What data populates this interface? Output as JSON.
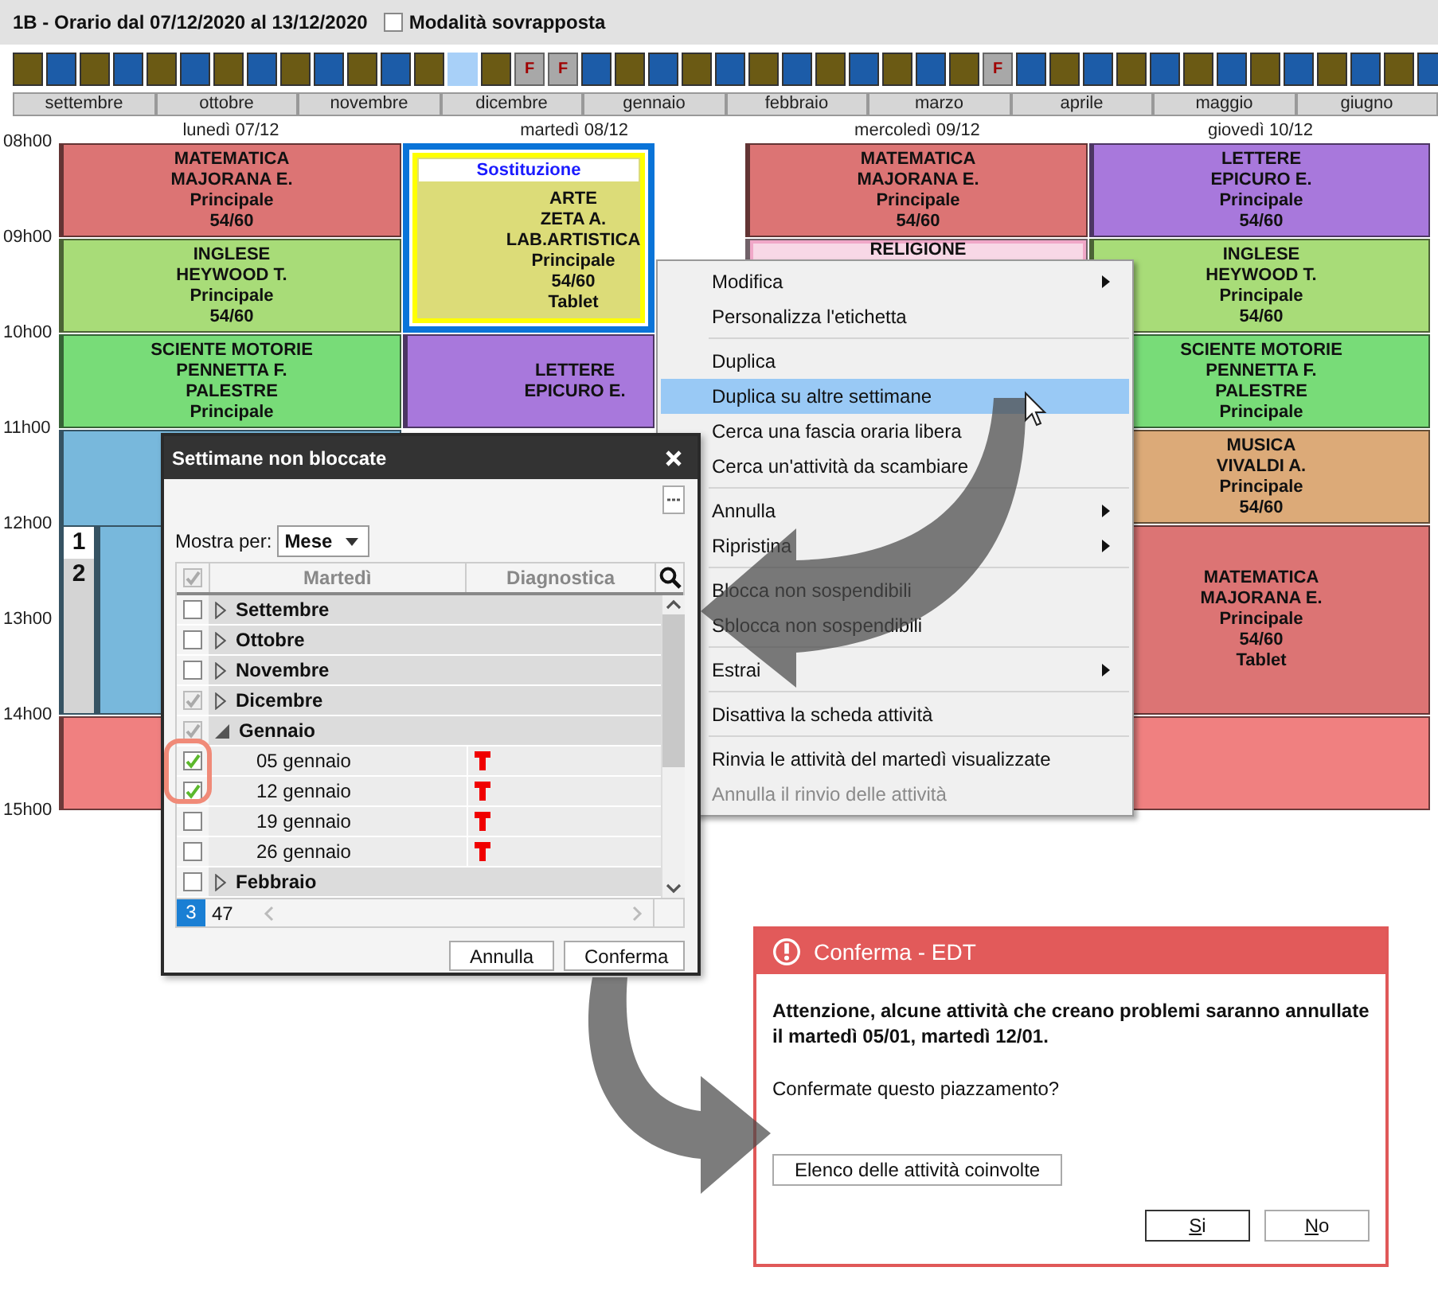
{
  "header": {
    "title": "1B - Orario dal 07/12/2020 al 13/12/2020",
    "overlay_mode": {
      "label": "Modalità sovrapposta",
      "checked": false
    }
  },
  "weeks": [
    {
      "kind": "a"
    },
    {
      "kind": "b"
    },
    {
      "kind": "a"
    },
    {
      "kind": "b"
    },
    {
      "kind": "a"
    },
    {
      "kind": "b"
    },
    {
      "kind": "a"
    },
    {
      "kind": "b"
    },
    {
      "kind": "a"
    },
    {
      "kind": "b"
    },
    {
      "kind": "a"
    },
    {
      "kind": "b"
    },
    {
      "kind": "a"
    },
    {
      "kind": "current"
    },
    {
      "kind": "a"
    },
    {
      "kind": "holiday",
      "label": "F"
    },
    {
      "kind": "holiday",
      "label": "F"
    },
    {
      "kind": "b"
    },
    {
      "kind": "a"
    },
    {
      "kind": "b"
    },
    {
      "kind": "a"
    },
    {
      "kind": "b"
    },
    {
      "kind": "a"
    },
    {
      "kind": "b"
    },
    {
      "kind": "a"
    },
    {
      "kind": "b"
    },
    {
      "kind": "a"
    },
    {
      "kind": "b"
    },
    {
      "kind": "a"
    },
    {
      "kind": "holiday",
      "label": "F"
    },
    {
      "kind": "b"
    },
    {
      "kind": "a"
    },
    {
      "kind": "b"
    },
    {
      "kind": "a"
    },
    {
      "kind": "b"
    },
    {
      "kind": "a"
    },
    {
      "kind": "b"
    },
    {
      "kind": "a"
    },
    {
      "kind": "b"
    },
    {
      "kind": "a"
    },
    {
      "kind": "b"
    },
    {
      "kind": "a"
    },
    {
      "kind": "b"
    }
  ],
  "months": [
    "settembre",
    "ottobre",
    "novembre",
    "dicembre",
    "gennaio",
    "febbraio",
    "marzo",
    "aprile",
    "maggio",
    "giugno"
  ],
  "timetable": {
    "hours": [
      "08h00",
      "09h00",
      "10h00",
      "11h00",
      "12h00",
      "13h00",
      "14h00",
      "15h00"
    ],
    "days": [
      {
        "label": "lunedì 07/12",
        "lessons": [
          {
            "kind": "lesson",
            "long": false,
            "color": "#dc7474",
            "selected": false,
            "lines": [
              "MATEMATICA",
              "MAJORANA E.",
              "Principale",
              "54/60"
            ]
          },
          {
            "kind": "lesson",
            "long": false,
            "color": "#a8dc78",
            "selected": false,
            "lines": [
              "INGLESE",
              "HEYWOOD T.",
              "Principale",
              "54/60"
            ]
          },
          {
            "kind": "lesson",
            "long": false,
            "color": "#78dc78",
            "selected": false,
            "lines": [
              "SCIENTE MOTORIE",
              "PENNETTA F.",
              "PALESTRE",
              "Principale"
            ]
          },
          {
            "kind": "group",
            "color": "#78b8dc",
            "selected": false,
            "parts": [
              {
                "label": "1",
                "selected": true
              },
              {
                "label": "2",
                "selected": false
              }
            ]
          },
          {
            "kind": "empty",
            "long": false,
            "color": "#f08080",
            "selected": false
          }
        ]
      },
      {
        "label": "martedì 08/12",
        "lessons": [
          {
            "kind": "substitution",
            "long": true,
            "color": "#dcdc78",
            "selected": true,
            "banner": "Sostituzione",
            "lines": [
              "ARTE",
              "ZETA A.",
              "LAB.ARTISTICA",
              "Principale",
              "54/60",
              "Tablet"
            ]
          },
          {
            "kind": "lesson",
            "long": false,
            "color": "#a878dc",
            "selected": false,
            "lines": [
              "LETTERE",
              "EPICURO E."
            ]
          }
        ]
      },
      {
        "label": "mercoledì 09/12",
        "lessons": [
          {
            "kind": "lesson",
            "long": false,
            "color": "#dc7474",
            "selected": false,
            "lines": [
              "MATEMATICA",
              "MAJORANA E.",
              "Principale",
              "54/60"
            ]
          },
          {
            "kind": "inset",
            "long": false,
            "color": "#f8d8e6",
            "selected": false,
            "lines": [
              "RELIGIONE"
            ]
          }
        ]
      },
      {
        "label": "giovedì 10/12",
        "lessons": [
          {
            "kind": "lesson",
            "long": false,
            "color": "#a878dc",
            "selected": false,
            "lines": [
              "LETTERE",
              "EPICURO E.",
              "Principale",
              "54/60"
            ]
          },
          {
            "kind": "lesson",
            "long": false,
            "color": "#a8dc78",
            "selected": false,
            "lines": [
              "INGLESE",
              "HEYWOOD T.",
              "Principale",
              "54/60"
            ]
          },
          {
            "kind": "lesson",
            "long": false,
            "color": "#78dc78",
            "selected": false,
            "lines": [
              "SCIENTE MOTORIE",
              "PENNETTA F.",
              "PALESTRE",
              "Principale"
            ]
          },
          {
            "kind": "lesson",
            "long": false,
            "color": "#dcaa78",
            "selected": false,
            "lines": [
              "MUSICA",
              "VIVALDI A.",
              "Principale",
              "54/60"
            ]
          },
          {
            "kind": "lesson",
            "long": true,
            "color": "#dc7474",
            "selected": false,
            "lines": [
              "MATEMATICA",
              "MAJORANA E.",
              "Principale",
              "54/60",
              "Tablet"
            ]
          },
          {
            "kind": "empty",
            "long": false,
            "color": "#f08080",
            "selected": false
          }
        ]
      }
    ]
  },
  "context_menu": {
    "items": [
      {
        "kind": "item",
        "label": "Modifica",
        "submenu": true,
        "selected": false,
        "disabled": false
      },
      {
        "kind": "item",
        "label": "Personalizza l'etichetta",
        "submenu": false,
        "selected": false,
        "disabled": false
      },
      {
        "kind": "separator"
      },
      {
        "kind": "item",
        "label": "Duplica",
        "submenu": false,
        "selected": false,
        "disabled": false
      },
      {
        "kind": "item",
        "label": "Duplica su altre settimane",
        "submenu": false,
        "selected": true,
        "disabled": false
      },
      {
        "kind": "item",
        "label": "Cerca una fascia oraria libera",
        "submenu": false,
        "selected": false,
        "disabled": false
      },
      {
        "kind": "item",
        "label": "Cerca un'attività da scambiare",
        "submenu": false,
        "selected": false,
        "disabled": false
      },
      {
        "kind": "separator"
      },
      {
        "kind": "item",
        "label": "Annulla",
        "submenu": true,
        "selected": false,
        "disabled": false
      },
      {
        "kind": "item",
        "label": "Ripristina",
        "submenu": true,
        "selected": false,
        "disabled": false
      },
      {
        "kind": "separator"
      },
      {
        "kind": "item",
        "label": "Blocca non sospendibili",
        "submenu": false,
        "selected": false,
        "disabled": false
      },
      {
        "kind": "item",
        "label": "Sblocca non sospendibili",
        "submenu": false,
        "selected": false,
        "disabled": false
      },
      {
        "kind": "separator"
      },
      {
        "kind": "item",
        "label": "Estrai",
        "submenu": true,
        "selected": false,
        "disabled": false
      },
      {
        "kind": "separator"
      },
      {
        "kind": "item",
        "label": "Disattiva la scheda attività",
        "submenu": false,
        "selected": false,
        "disabled": false
      },
      {
        "kind": "separator"
      },
      {
        "kind": "item",
        "label": "Rinvia le attività del martedì visualizzate",
        "submenu": false,
        "selected": false,
        "disabled": false
      },
      {
        "kind": "item",
        "label": "Annulla il rinvio delle attività",
        "submenu": false,
        "selected": false,
        "disabled": true
      }
    ]
  },
  "weeks_dialog": {
    "title": "Settimane non bloccate",
    "show_by_label": "Mostra per:",
    "show_by": "Mese",
    "header_checkbox": {
      "checked": true,
      "disabled": true
    },
    "columns": [
      "Martedì",
      "Diagnostica"
    ],
    "rows": [
      {
        "kind": "group",
        "label": "Settembre",
        "checked": false,
        "disabled": false,
        "expanded": false
      },
      {
        "kind": "group",
        "label": "Ottobre",
        "checked": false,
        "disabled": false,
        "expanded": false
      },
      {
        "kind": "group",
        "label": "Novembre",
        "checked": false,
        "disabled": false,
        "expanded": false
      },
      {
        "kind": "group",
        "label": "Dicembre",
        "checked": true,
        "disabled": true,
        "expanded": false
      },
      {
        "kind": "group",
        "label": "Gennaio",
        "checked": true,
        "disabled": true,
        "expanded": true
      },
      {
        "kind": "week",
        "label": "05 gennaio",
        "checked": true,
        "disabled": false,
        "warning": true
      },
      {
        "kind": "week",
        "label": "12 gennaio",
        "checked": true,
        "disabled": false,
        "warning": true
      },
      {
        "kind": "week",
        "label": "19 gennaio",
        "checked": false,
        "disabled": false,
        "warning": true
      },
      {
        "kind": "week",
        "label": "26 gennaio",
        "checked": false,
        "disabled": false,
        "warning": true
      },
      {
        "kind": "group",
        "label": "Febbraio",
        "checked": false,
        "disabled": false,
        "expanded": false
      }
    ],
    "selected_count": "3",
    "total_count": "47",
    "buttons": [
      "Annulla",
      "Conferma"
    ]
  },
  "confirm_dialog": {
    "title": "Conferma - EDT",
    "message": "Attenzione, alcune attività che creano problemi saranno annullate il martedì 05/01, martedì 12/01.",
    "question": "Confermate questo piazzamento?",
    "list_button": "Elenco delle attività coinvolte",
    "buttons": [
      {
        "label": "Si",
        "default": true
      },
      {
        "label": "No",
        "default": false
      }
    ]
  }
}
